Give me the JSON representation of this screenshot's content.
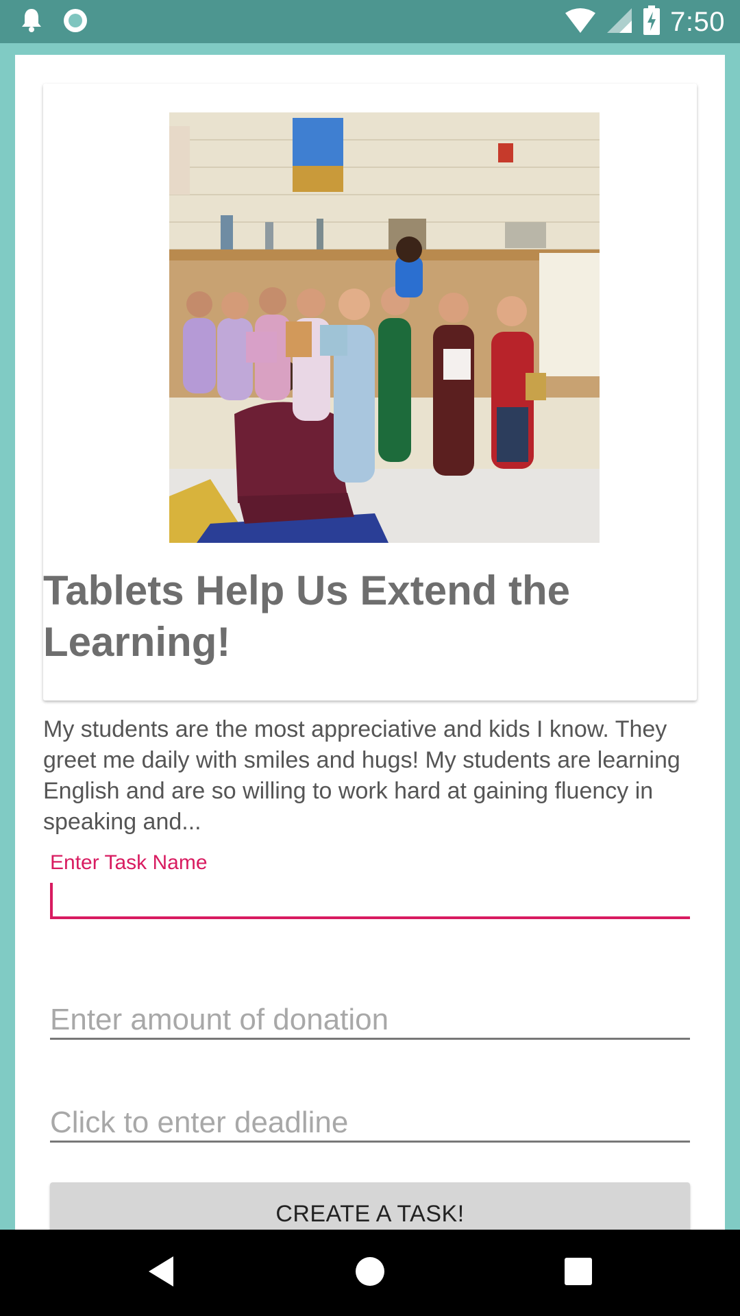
{
  "status_bar": {
    "time": "7:50",
    "icons": [
      "notification-bell-icon",
      "sync-circle-icon",
      "wifi-icon",
      "cell-signal-icon",
      "battery-charging-icon"
    ]
  },
  "project": {
    "title": "Tablets Help Us Extend the Learning!",
    "photo_icon": "classroom-photo",
    "description": "My students are the most appreciative and kids I know. They greet me daily with smiles and hugs! My students are learning English and are so willing to work hard at gaining fluency in speaking and..."
  },
  "form": {
    "task_name": {
      "label": "Enter Task Name",
      "value": ""
    },
    "donation": {
      "placeholder": "Enter amount of donation",
      "value": ""
    },
    "deadline": {
      "placeholder": "Click to enter deadline",
      "value": ""
    },
    "submit_label": "CREATE A TASK!"
  },
  "nav_bar": {
    "icons": [
      "back-icon",
      "home-icon",
      "recents-icon"
    ]
  },
  "colors": {
    "status_bar": "#4d9690",
    "frame": "#80cbc4",
    "accent": "#d81b60",
    "button": "#d6d6d6"
  }
}
